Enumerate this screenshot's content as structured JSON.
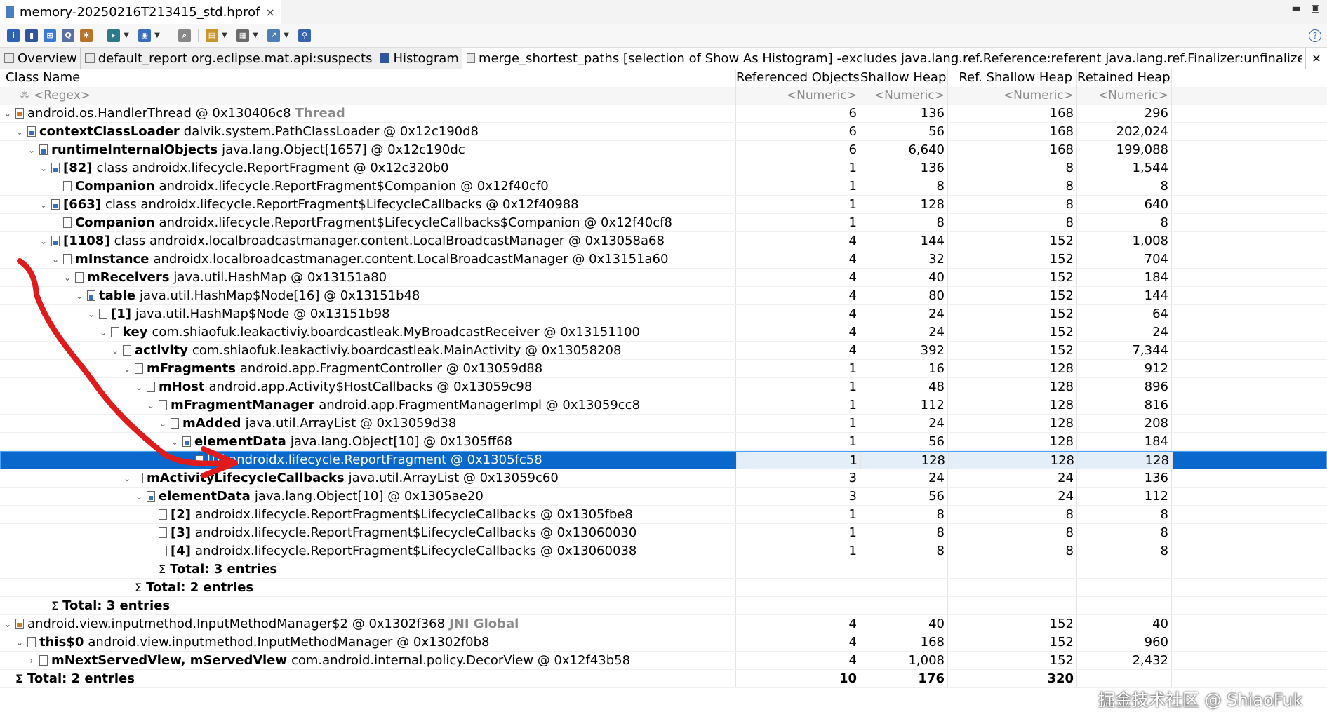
{
  "editor": {
    "tab_title": "memory-20250216T213415_std.hprof",
    "close": "×"
  },
  "window_controls": {
    "minimize": "▬",
    "maximize": "▣"
  },
  "toolbar": {
    "buttons": [
      "info-icon",
      "histogram-icon",
      "dominator-tree-icon",
      "oql-icon",
      "top-consumers-icon",
      "run-report-icon",
      "query-browser-icon",
      "search-icon",
      "group-by-icon",
      "calc-retained-icon",
      "export-icon",
      "pin-icon"
    ],
    "help": "?"
  },
  "subtabs": [
    {
      "label": "Overview"
    },
    {
      "label": "default_report org.eclipse.mat.api:suspects"
    },
    {
      "label": "Histogram"
    },
    {
      "label": "merge_shortest_paths [selection of Show As Histogram] -excludes java.lang.ref.Reference:referent java.lang.ref.Finalizer:unfinalized java.lang.Runtime:<..."
    }
  ],
  "subtab_close": "✕",
  "columns": {
    "name": "Class Name",
    "ref_objects": "Referenced Objects",
    "shallow": "Shallow Heap",
    "ref_shallow": "Ref. Shallow Heap",
    "retained": "Retained Heap"
  },
  "filters": {
    "name": "<Regex>",
    "numeric": "<Numeric>"
  },
  "rows": [
    {
      "bold": "",
      "text": "android.os.HandlerThread @ 0x130406c8",
      "gray": "Thread",
      "ro": "6",
      "sh": "136",
      "rsh": "168",
      "rh": "296"
    },
    {
      "bold": "contextClassLoader",
      "text": "dalvik.system.PathClassLoader @ 0x12c190d8",
      "gray": "",
      "ro": "6",
      "sh": "56",
      "rsh": "168",
      "rh": "202,024"
    },
    {
      "bold": "runtimeInternalObjects",
      "text": "java.lang.Object[1657] @ 0x12c190dc",
      "gray": "",
      "ro": "6",
      "sh": "6,640",
      "rsh": "168",
      "rh": "199,088"
    },
    {
      "bold": "[82]",
      "text": "class androidx.lifecycle.ReportFragment @ 0x12c320b0",
      "gray": "",
      "ro": "1",
      "sh": "136",
      "rsh": "8",
      "rh": "1,544"
    },
    {
      "bold": "Companion",
      "text": "androidx.lifecycle.ReportFragment$Companion @ 0x12f40cf0",
      "gray": "",
      "ro": "1",
      "sh": "8",
      "rsh": "8",
      "rh": "8"
    },
    {
      "bold": "[663]",
      "text": "class androidx.lifecycle.ReportFragment$LifecycleCallbacks @ 0x12f40988",
      "gray": "",
      "ro": "1",
      "sh": "128",
      "rsh": "8",
      "rh": "640"
    },
    {
      "bold": "Companion",
      "text": "androidx.lifecycle.ReportFragment$LifecycleCallbacks$Companion @ 0x12f40cf8",
      "gray": "",
      "ro": "1",
      "sh": "8",
      "rsh": "8",
      "rh": "8"
    },
    {
      "bold": "[1108]",
      "text": "class androidx.localbroadcastmanager.content.LocalBroadcastManager @ 0x13058a68",
      "gray": "",
      "ro": "4",
      "sh": "144",
      "rsh": "152",
      "rh": "1,008"
    },
    {
      "bold": "mInstance",
      "text": "androidx.localbroadcastmanager.content.LocalBroadcastManager @ 0x13151a60",
      "gray": "",
      "ro": "4",
      "sh": "32",
      "rsh": "152",
      "rh": "704"
    },
    {
      "bold": "mReceivers",
      "text": "java.util.HashMap @ 0x13151a80",
      "gray": "",
      "ro": "4",
      "sh": "40",
      "rsh": "152",
      "rh": "184"
    },
    {
      "bold": "table",
      "text": "java.util.HashMap$Node[16] @ 0x13151b48",
      "gray": "",
      "ro": "4",
      "sh": "80",
      "rsh": "152",
      "rh": "144"
    },
    {
      "bold": "[1]",
      "text": "java.util.HashMap$Node @ 0x13151b98",
      "gray": "",
      "ro": "4",
      "sh": "24",
      "rsh": "152",
      "rh": "64"
    },
    {
      "bold": "key",
      "text": "com.shiaofuk.leakactiviy.boardcastleak.MyBroadcastReceiver @ 0x13151100",
      "gray": "",
      "ro": "4",
      "sh": "24",
      "rsh": "152",
      "rh": "24"
    },
    {
      "bold": "activity",
      "text": "com.shiaofuk.leakactiviy.boardcastleak.MainActivity @ 0x13058208",
      "gray": "",
      "ro": "4",
      "sh": "392",
      "rsh": "152",
      "rh": "7,344"
    },
    {
      "bold": "mFragments",
      "text": "android.app.FragmentController @ 0x13059d88",
      "gray": "",
      "ro": "1",
      "sh": "16",
      "rsh": "128",
      "rh": "912"
    },
    {
      "bold": "mHost",
      "text": "android.app.Activity$HostCallbacks @ 0x13059c98",
      "gray": "",
      "ro": "1",
      "sh": "48",
      "rsh": "128",
      "rh": "896"
    },
    {
      "bold": "mFragmentManager",
      "text": "android.app.FragmentManagerImpl @ 0x13059cc8",
      "gray": "",
      "ro": "1",
      "sh": "112",
      "rsh": "128",
      "rh": "816"
    },
    {
      "bold": "mAdded",
      "text": "java.util.ArrayList @ 0x13059d38",
      "gray": "",
      "ro": "1",
      "sh": "24",
      "rsh": "128",
      "rh": "208"
    },
    {
      "bold": "elementData",
      "text": "java.lang.Object[10] @ 0x1305ff68",
      "gray": "",
      "ro": "1",
      "sh": "56",
      "rsh": "128",
      "rh": "184"
    },
    {
      "bold": "",
      "text": "[0] androidx.lifecycle.ReportFragment @ 0x1305fc58",
      "gray": "",
      "ro": "1",
      "sh": "128",
      "rsh": "128",
      "rh": "128"
    },
    {
      "bold": "mActivityLifecycleCallbacks",
      "text": "java.util.ArrayList @ 0x13059c60",
      "gray": "",
      "ro": "3",
      "sh": "24",
      "rsh": "24",
      "rh": "136"
    },
    {
      "bold": "elementData",
      "text": "java.lang.Object[10] @ 0x1305ae20",
      "gray": "",
      "ro": "3",
      "sh": "56",
      "rsh": "24",
      "rh": "112"
    },
    {
      "bold": "[2]",
      "text": "androidx.lifecycle.ReportFragment$LifecycleCallbacks @ 0x1305fbe8",
      "gray": "",
      "ro": "1",
      "sh": "8",
      "rsh": "8",
      "rh": "8"
    },
    {
      "bold": "[3]",
      "text": "androidx.lifecycle.ReportFragment$LifecycleCallbacks @ 0x13060030",
      "gray": "",
      "ro": "1",
      "sh": "8",
      "rsh": "8",
      "rh": "8"
    },
    {
      "bold": "[4]",
      "text": "androidx.lifecycle.ReportFragment$LifecycleCallbacks @ 0x13060038",
      "gray": "",
      "ro": "1",
      "sh": "8",
      "rsh": "8",
      "rh": "8"
    },
    {
      "bold": "Total: 3 entries",
      "text": "",
      "gray": "",
      "ro": "",
      "sh": "",
      "rsh": "",
      "rh": ""
    },
    {
      "bold": "Total: 2 entries",
      "text": "",
      "gray": "",
      "ro": "",
      "sh": "",
      "rsh": "",
      "rh": ""
    },
    {
      "bold": "Total: 3 entries",
      "text": "",
      "gray": "",
      "ro": "",
      "sh": "",
      "rsh": "",
      "rh": ""
    },
    {
      "bold": "",
      "text": "android.view.inputmethod.InputMethodManager$2 @ 0x1302f368",
      "gray": "JNI Global",
      "ro": "4",
      "sh": "40",
      "rsh": "152",
      "rh": "40"
    },
    {
      "bold": "this$0",
      "text": "android.view.inputmethod.InputMethodManager @ 0x1302f0b8",
      "gray": "",
      "ro": "4",
      "sh": "168",
      "rsh": "152",
      "rh": "960"
    },
    {
      "bold": "mNextServedView, mServedView",
      "text": "com.android.internal.policy.DecorView @ 0x12f43b58",
      "gray": "",
      "ro": "4",
      "sh": "1,008",
      "rsh": "152",
      "rh": "2,432"
    },
    {
      "bold": "Total: 2 entries",
      "text": "",
      "gray": "",
      "ro": "10",
      "sh": "176",
      "rsh": "320",
      "rh": ""
    }
  ],
  "watermark": "掘金技术社区 @ ShiaoFuk",
  "colors": {
    "selection": "#0a68cc",
    "annotation": "#e01b1b"
  }
}
